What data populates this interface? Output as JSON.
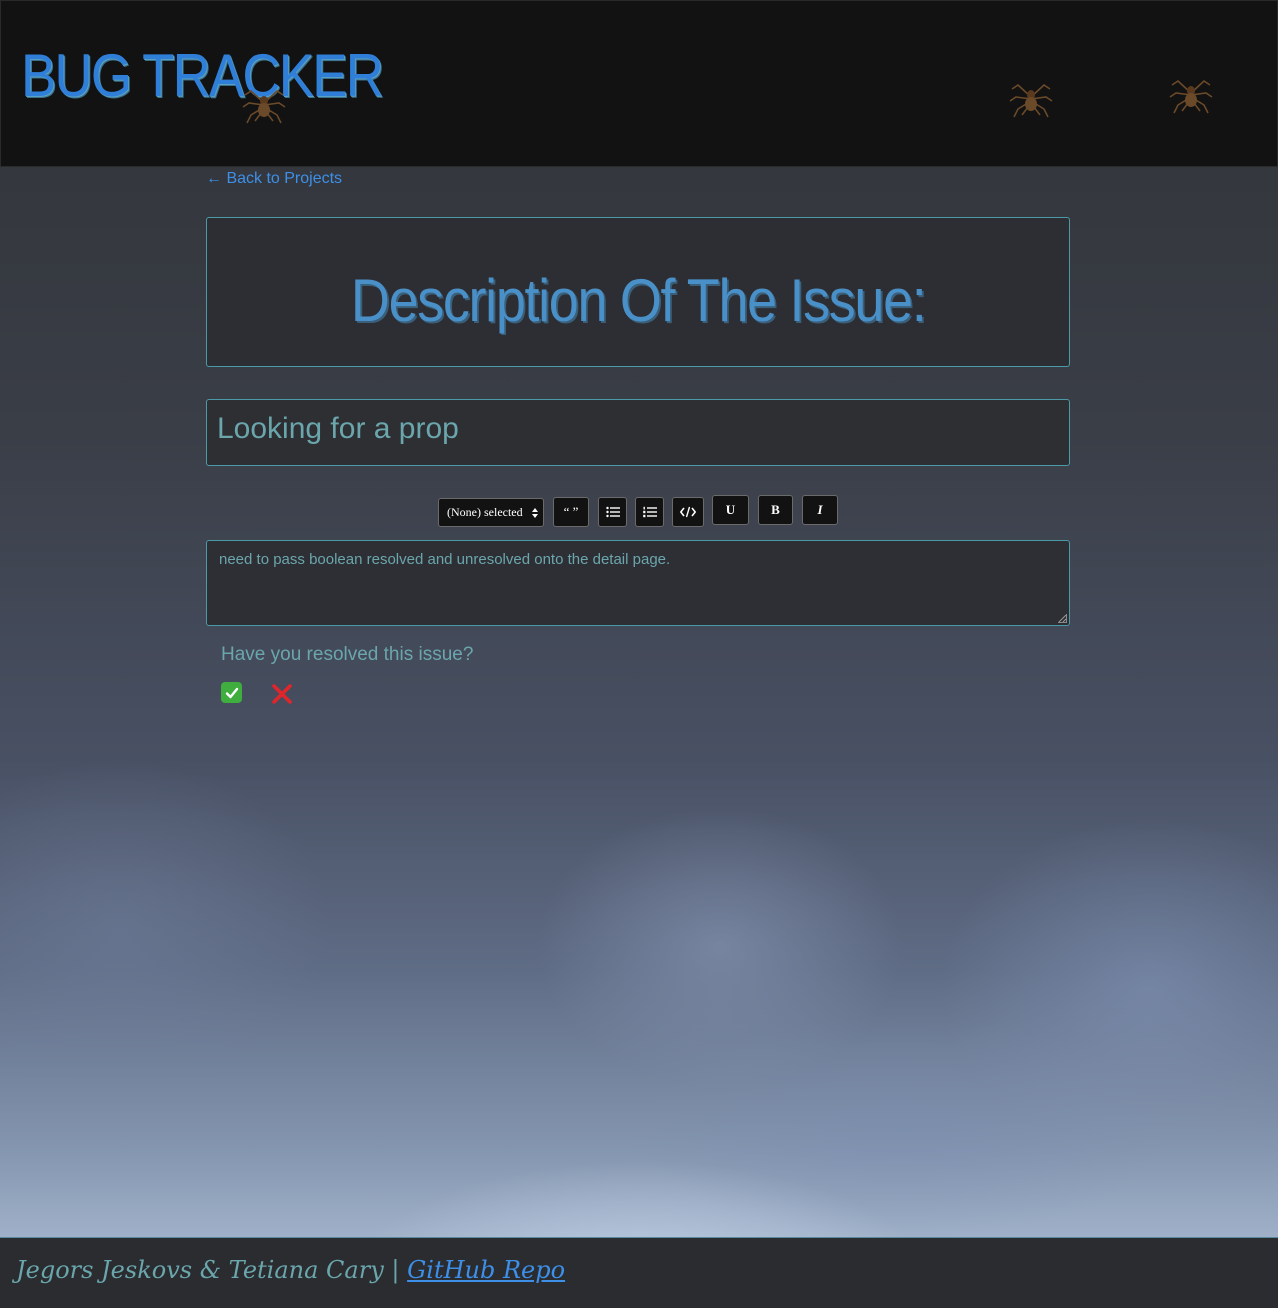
{
  "header": {
    "brand": "BUG TRACKER"
  },
  "nav": {
    "back_arrow": "←",
    "back_label": "Back to Projects"
  },
  "issue": {
    "heading": "Description Of The Issue:",
    "title_value": "Looking for a prop",
    "description_value": "need to pass boolean resolved and unresolved onto the detail page."
  },
  "toolbar": {
    "heading_select": "(None) selected",
    "quote_label": "“ ”",
    "underline_label": "U",
    "bold_label": "B",
    "italic_label": "I"
  },
  "resolution": {
    "question": "Have you resolved this issue?"
  },
  "footer": {
    "authors": "Jegors Jeskovs & Tetiana Cary | ",
    "repo_link": "GitHub Repo"
  },
  "colors": {
    "accent": "#3d8fe8",
    "text_teal": "#6aa6ac",
    "border_teal": "#4a9aa8"
  }
}
